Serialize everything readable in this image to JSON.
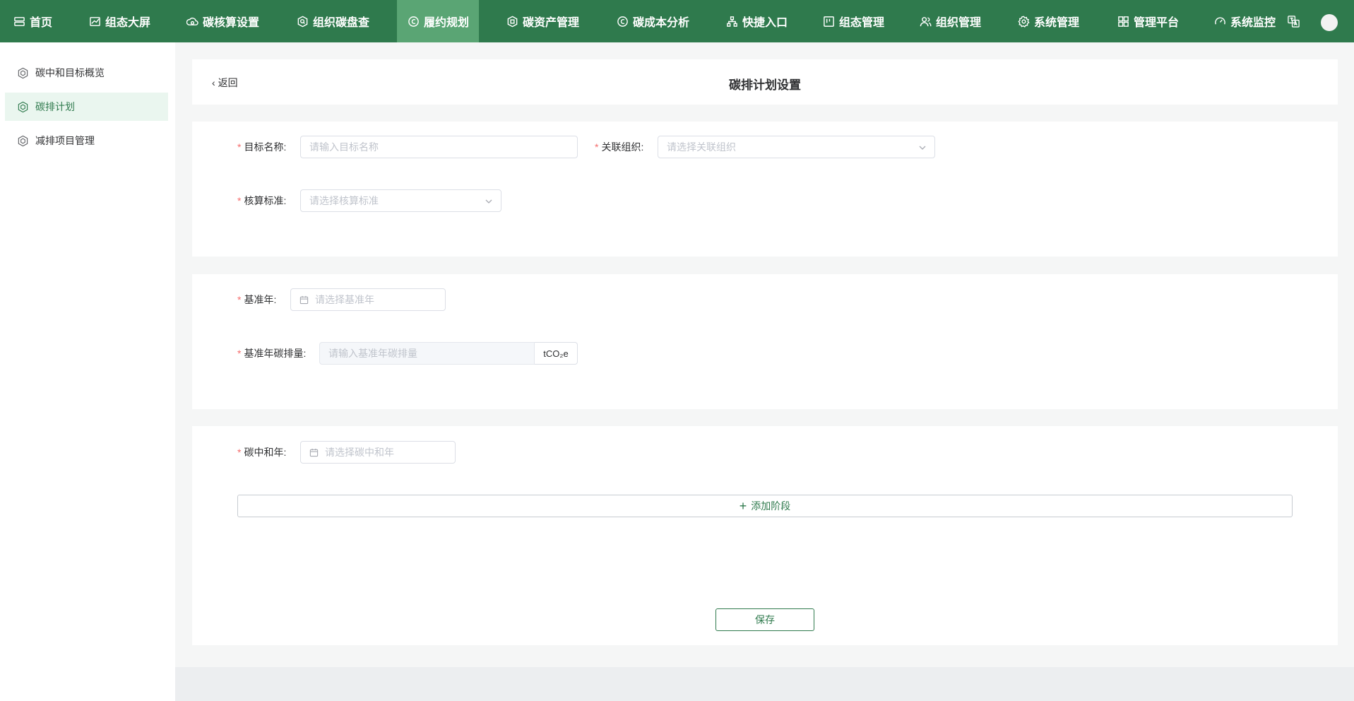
{
  "nav": {
    "items": [
      {
        "label": "首页",
        "icon": "server-icon"
      },
      {
        "label": "组态大屏",
        "icon": "line-chart-icon"
      },
      {
        "label": "碳核算设置",
        "icon": "cloud-carbon-icon"
      },
      {
        "label": "组织碳盘查",
        "icon": "search-shield-icon"
      },
      {
        "label": "履约规划",
        "icon": "carbon-circle-icon"
      },
      {
        "label": "碳资产管理",
        "icon": "hexagon-asset-icon"
      },
      {
        "label": "碳成本分析",
        "icon": "carbon-c-icon"
      },
      {
        "label": "快捷入口",
        "icon": "org-tree-icon"
      },
      {
        "label": "组态管理",
        "icon": "layout-board-icon"
      },
      {
        "label": "组织管理",
        "icon": "users-icon"
      },
      {
        "label": "系统管理",
        "icon": "gear-icon"
      },
      {
        "label": "管理平台",
        "icon": "grid-icon"
      },
      {
        "label": "系统监控",
        "icon": "dashboard-gauge-icon"
      }
    ],
    "active_index": 4,
    "right_icons": [
      "translate-icon",
      "avatar"
    ]
  },
  "sidebar": {
    "items": [
      {
        "label": "碳中和目标概览",
        "icon": "hexagon-icon"
      },
      {
        "label": "碳排计划",
        "icon": "hexagon-icon"
      },
      {
        "label": "减排项目管理",
        "icon": "hexagon-icon"
      }
    ],
    "active_index": 1
  },
  "header": {
    "back_label": "返回",
    "title": "碳排计划设置"
  },
  "form": {
    "target_name": {
      "label": "目标名称:",
      "placeholder": "请输入目标名称"
    },
    "related_org": {
      "label": "关联组织:",
      "placeholder": "请选择关联组织"
    },
    "standard": {
      "label": "核算标准:",
      "placeholder": "请选择核算标准"
    },
    "base_year": {
      "label": "基准年:",
      "placeholder": "请选择基准年"
    },
    "base_emission": {
      "label": "基准年碳排量:",
      "placeholder": "请输入基准年碳排量",
      "unit": "tCO₂e"
    },
    "neutral_year": {
      "label": "碳中和年:",
      "placeholder": "请选择碳中和年"
    },
    "required_mark": "*"
  },
  "actions": {
    "add_stage": "添加阶段",
    "add_stage_icon": "plus-icon",
    "save": "保存"
  },
  "colors": {
    "brand": "#2f7a4d",
    "nav_active": "#5aa574",
    "sidebar_active_bg": "#eaf6ef",
    "required": "#f56c6c"
  }
}
